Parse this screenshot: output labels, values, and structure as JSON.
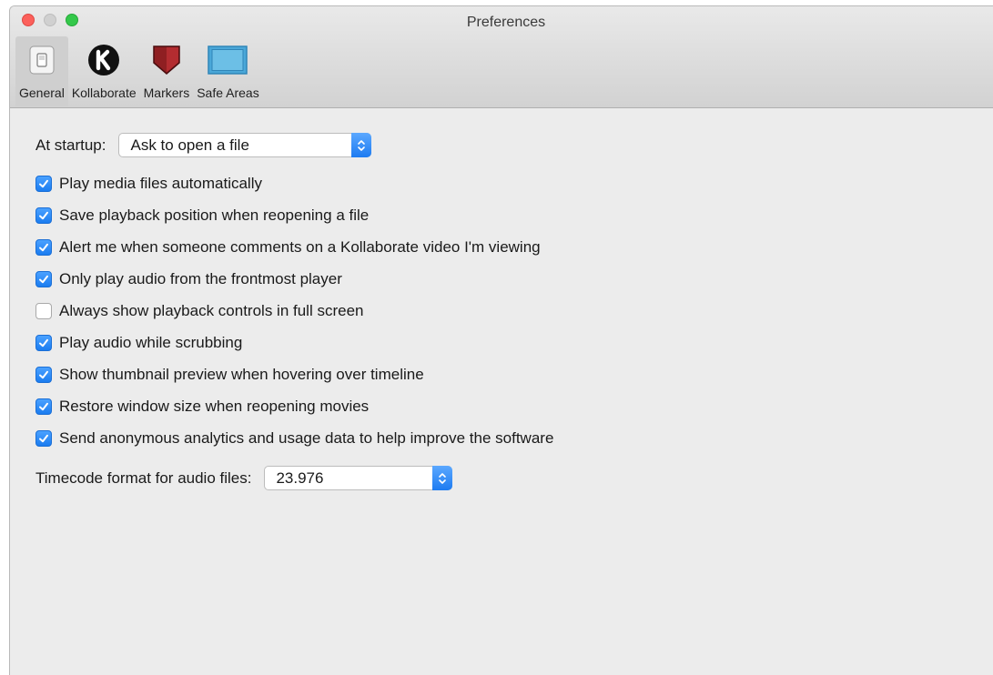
{
  "window": {
    "title": "Preferences"
  },
  "toolbar": {
    "tabs": [
      {
        "label": "General",
        "icon": "switch-icon",
        "active": true
      },
      {
        "label": "Kollaborate",
        "icon": "kollaborate-logo-icon",
        "active": false
      },
      {
        "label": "Markers",
        "icon": "marker-shield-icon",
        "active": false
      },
      {
        "label": "Safe Areas",
        "icon": "safe-area-screen-icon",
        "active": false
      }
    ]
  },
  "general": {
    "startup_label": "At startup:",
    "startup_value": "Ask to open a file",
    "options": [
      {
        "label": "Play media files automatically",
        "checked": true
      },
      {
        "label": "Save playback position when reopening a file",
        "checked": true
      },
      {
        "label": "Alert me when someone comments on a Kollaborate video I'm viewing",
        "checked": true
      },
      {
        "label": "Only play audio from the frontmost player",
        "checked": true
      },
      {
        "label": "Always show playback controls in full screen",
        "checked": false
      },
      {
        "label": "Play audio while scrubbing",
        "checked": true
      },
      {
        "label": "Show thumbnail preview when hovering over timeline",
        "checked": true
      },
      {
        "label": "Restore window size when reopening movies",
        "checked": true
      },
      {
        "label": "Send anonymous analytics and usage data to help improve the software",
        "checked": true
      }
    ],
    "timecode_label": "Timecode format for audio files:",
    "timecode_value": "23.976"
  },
  "colors": {
    "accent": "#1a7cf0",
    "window_background": "#ececec",
    "close_button": "#fc605b",
    "zoom_button": "#34c84a"
  }
}
